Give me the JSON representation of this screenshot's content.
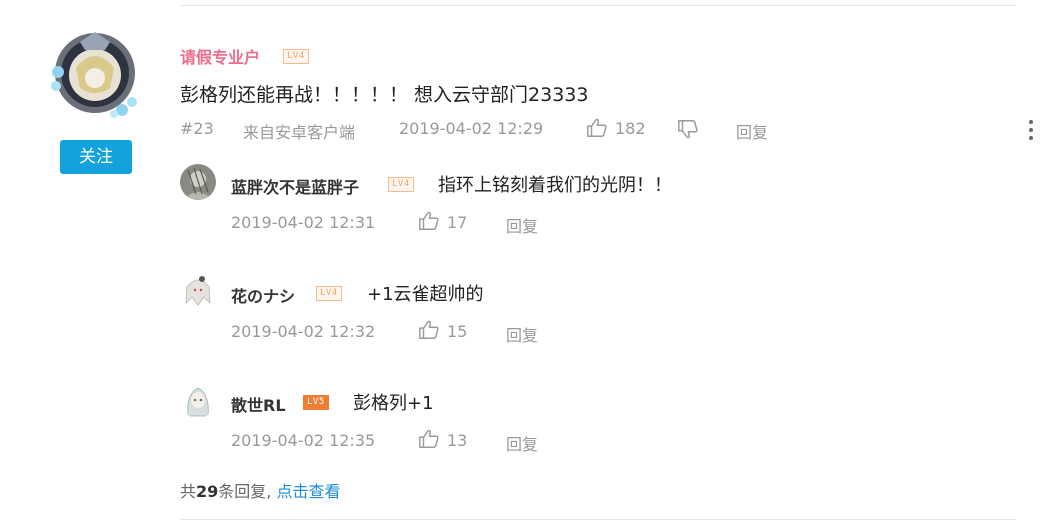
{
  "post": {
    "username": "请假专业户",
    "level": "LV4",
    "content": "彭格列还能再战！！！！！ 想入云守部门23333",
    "floor": "#23",
    "source": "来自安卓客户端",
    "time": "2019-04-02 12:29",
    "likes": "182",
    "reply_label": "回复",
    "follow_label": "关注"
  },
  "replies": [
    {
      "username": "蓝胖次不是蓝胖子",
      "level": "LV4",
      "text": "指环上铭刻着我们的光阴！！",
      "time": "2019-04-02 12:31",
      "likes": "17",
      "reply_label": "回复"
    },
    {
      "username": "花のナシ",
      "level": "LV4",
      "text": "+1云雀超帅的",
      "time": "2019-04-02 12:32",
      "likes": "15",
      "reply_label": "回复"
    },
    {
      "username": "散世RL",
      "level": "LV5",
      "text": "彭格列+1",
      "time": "2019-04-02 12:35",
      "likes": "13",
      "reply_label": "回复"
    }
  ],
  "footer": {
    "prefix": "共",
    "count": "29",
    "suffix": "条回复,",
    "view_link": "点击查看"
  },
  "colors": {
    "accent": "#13a3dc",
    "username_pink": "#ec6d8c",
    "level_orange": "#f6a26a",
    "link_blue": "#1a8fd6"
  },
  "icons": [
    "thumbs-up-icon",
    "thumbs-down-icon",
    "more-vertical-icon"
  ]
}
